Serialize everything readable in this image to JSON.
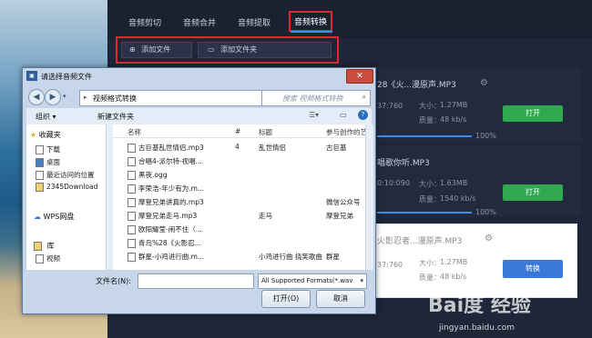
{
  "app": {
    "tabs": [
      "音频剪切",
      "音频合并",
      "音频提取",
      "音频转换"
    ],
    "active_tab_index": 3,
    "toolbar": {
      "add_file": "添加文件",
      "add_folder": "添加文件夹"
    },
    "items": [
      {
        "name": "28《火...漫原声.MP3",
        "duration": "37:760",
        "size_label": "大小：",
        "size": "1.27MB",
        "quality_label": "质量：",
        "quality": "48 kb/s",
        "progress_text": "100%",
        "action": "打开"
      },
      {
        "name": "唱歌你听.MP3",
        "duration": "0:10:090",
        "size_label": "大小：",
        "size": "1.63MB",
        "quality_label": "质量：",
        "quality": "1540 kb/s",
        "progress_text": "100%",
        "action": "打开"
      },
      {
        "name": "火影忍者...漫原声.MP3",
        "duration": "37:760",
        "size_label": "大小：",
        "size": "1.27MB",
        "quality_label": "质量：",
        "quality": "48 kb/s",
        "action": "转换"
      }
    ],
    "colors": {
      "accent": "#3e8ee8",
      "green": "#2fa84f",
      "highlight": "#e02a2a"
    }
  },
  "dialog": {
    "title": "请选择音频文件",
    "app_icon": "file-icon",
    "close": "✕",
    "address": "视频格式转换",
    "search_placeholder": "搜索 视频格式转换",
    "organize": "组织 ▾",
    "new_folder": "新建文件夹",
    "sidebar": {
      "favorites": "收藏夹",
      "fav_items": [
        "下载",
        "桌面",
        "最近访问的位置",
        "2345Download"
      ],
      "wps": "WPS网盘",
      "library": "库",
      "lib_items": [
        "视频"
      ]
    },
    "columns": {
      "name": "名称",
      "num": "#",
      "title": "标题",
      "artist": "参与创作的艺"
    },
    "rows": [
      {
        "name": "古巨基乱世情侣.mp3",
        "num": "4",
        "title": "乱世情侣",
        "artist": "古巨基"
      },
      {
        "name": "合唱4-派尔特-视唱...",
        "num": "",
        "title": "",
        "artist": ""
      },
      {
        "name": "黑夜.ogg",
        "num": "",
        "title": "",
        "artist": ""
      },
      {
        "name": "李荣浩-年少有为.m...",
        "num": "",
        "title": "",
        "artist": ""
      },
      {
        "name": "摩登兄弟讲真的.mp3",
        "num": "",
        "title": "",
        "artist": "微信公众号"
      },
      {
        "name": "摩登兄弟走马.mp3",
        "num": "",
        "title": "走马",
        "artist": "摩登兄弟"
      },
      {
        "name": "欧阳耀莹-闹不住（...",
        "num": "",
        "title": "",
        "artist": ""
      },
      {
        "name": "青鸟%28《火影忍...",
        "num": "",
        "title": "",
        "artist": ""
      },
      {
        "name": "群星-小鸡进行曲.m...",
        "num": "",
        "title": "小鸡进行曲 挠笑歌曲",
        "artist": "群星"
      }
    ],
    "filename_label": "文件名(N):",
    "filename_value": "",
    "filter": "All Supported Formats(*.wav",
    "open": "打开(O)",
    "cancel": "取消"
  },
  "watermark": {
    "brand": "Bai度 经验",
    "url": "jingyan.baidu.com"
  }
}
